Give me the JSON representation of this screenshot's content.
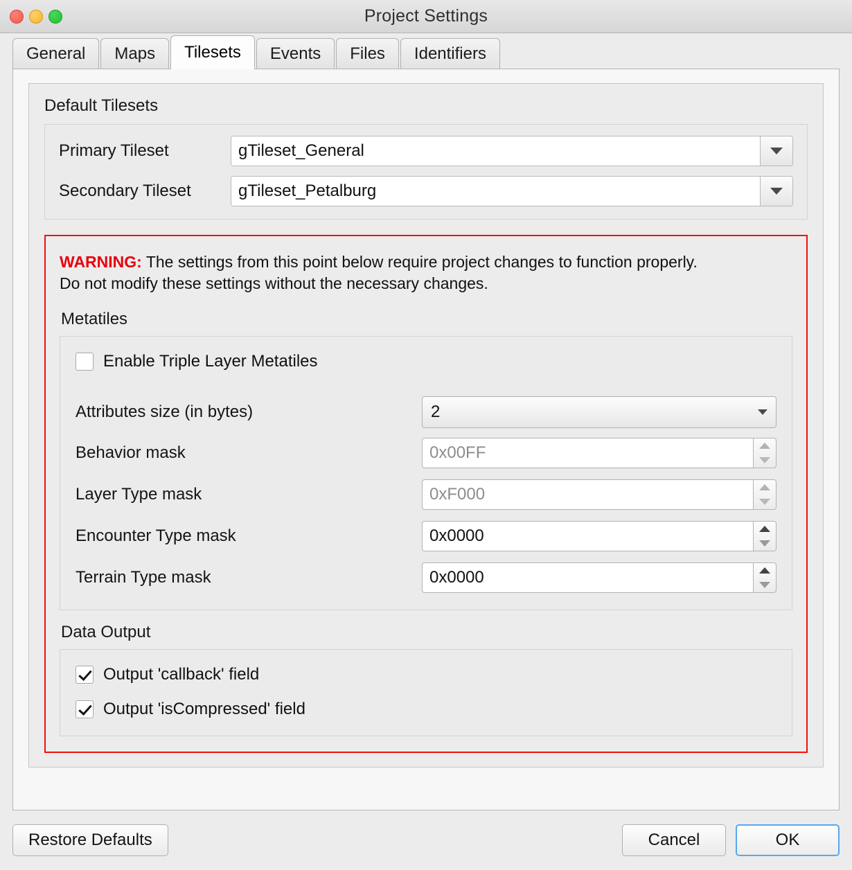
{
  "window": {
    "title": "Project Settings",
    "traffic_lights": [
      "close-button",
      "minimize-button",
      "maximize-button"
    ]
  },
  "tabs": [
    {
      "label": "General",
      "active": false
    },
    {
      "label": "Maps",
      "active": false
    },
    {
      "label": "Tilesets",
      "active": true
    },
    {
      "label": "Events",
      "active": false
    },
    {
      "label": "Files",
      "active": false
    },
    {
      "label": "Identifiers",
      "active": false
    }
  ],
  "default_tilesets": {
    "group_title": "Default Tilesets",
    "primary": {
      "label": "Primary Tileset",
      "value": "gTileset_General"
    },
    "secondary": {
      "label": "Secondary Tileset",
      "value": "gTileset_Petalburg"
    }
  },
  "warning": {
    "label": "WARNING:",
    "line1": "The settings from this point below require project changes to function properly.",
    "line2": "Do not modify these settings without the necessary changes.",
    "color": "#e8000c"
  },
  "metatiles": {
    "section_title": "Metatiles",
    "triple_layer": {
      "label": "Enable Triple Layer Metatiles",
      "checked": false
    },
    "attributes_size": {
      "label": "Attributes size (in bytes)",
      "value": "2"
    },
    "masks": [
      {
        "label": "Behavior mask",
        "value": "0x00FF",
        "disabled": true
      },
      {
        "label": "Layer Type mask",
        "value": "0xF000",
        "disabled": true
      },
      {
        "label": "Encounter Type mask",
        "value": "0x0000",
        "disabled": false
      },
      {
        "label": "Terrain Type mask",
        "value": "0x0000",
        "disabled": false
      }
    ]
  },
  "data_output": {
    "section_title": "Data Output",
    "options": [
      {
        "label": "Output 'callback' field",
        "checked": true
      },
      {
        "label": "Output 'isCompressed' field",
        "checked": true
      }
    ]
  },
  "footer": {
    "restore_defaults": "Restore Defaults",
    "cancel": "Cancel",
    "ok": "OK"
  }
}
